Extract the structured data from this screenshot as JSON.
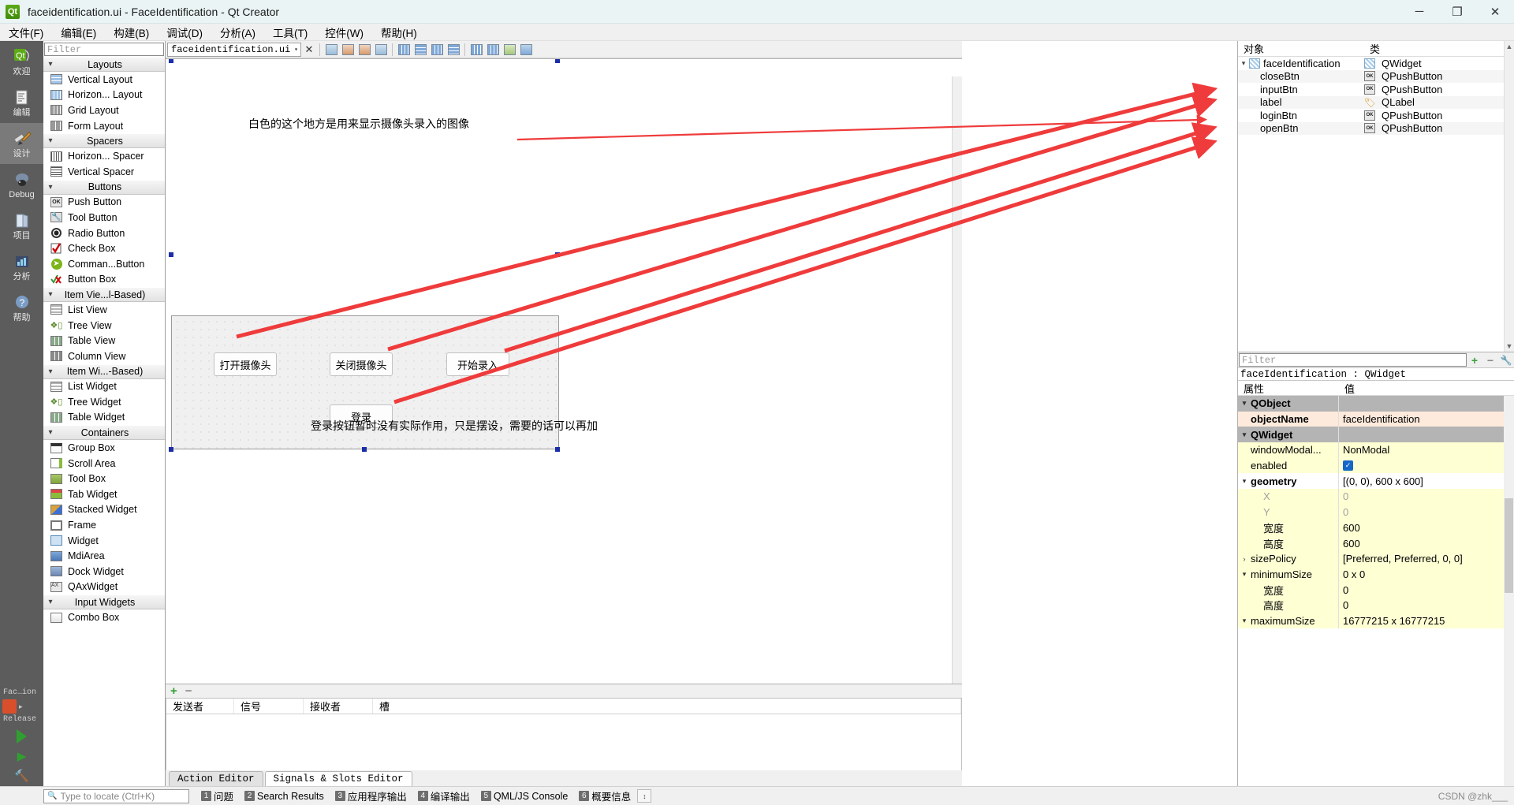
{
  "titlebar": {
    "icon": "qt-logo-icon",
    "title": "faceidentification.ui - FaceIdentification - Qt Creator",
    "minimize": "─",
    "maximize": "❐",
    "close": "✕"
  },
  "menubar": {
    "items": [
      {
        "label": "文件(F)"
      },
      {
        "label": "编辑(E)"
      },
      {
        "label": "构建(B)"
      },
      {
        "label": "调试(D)"
      },
      {
        "label": "分析(A)"
      },
      {
        "label": "工具(T)"
      },
      {
        "label": "控件(W)"
      },
      {
        "label": "帮助(H)"
      }
    ]
  },
  "modebar": {
    "items": [
      {
        "label": "欢迎",
        "icon": "qt-welcome-icon",
        "glyph": "Qt",
        "active": false
      },
      {
        "label": "编辑",
        "icon": "edit-icon",
        "glyph": "☰",
        "active": false
      },
      {
        "label": "设计",
        "icon": "design-brush-icon",
        "glyph": "✒",
        "active": true
      },
      {
        "label": "Debug",
        "icon": "debug-bug-icon",
        "glyph": "⚫",
        "active": false
      },
      {
        "label": "项目",
        "icon": "projects-icon",
        "glyph": "◧",
        "active": false
      },
      {
        "label": "分析",
        "icon": "analyze-icon",
        "glyph": "▦",
        "active": false
      },
      {
        "label": "帮助",
        "icon": "help-question-icon",
        "glyph": "?",
        "active": false
      }
    ],
    "kit_name": "Fac…ion",
    "build_config": "Release"
  },
  "widgetbox": {
    "filter_placeholder": "Filter",
    "groups": [
      {
        "label": "Layouts",
        "expanded": true,
        "items": [
          {
            "label": "Vertical Layout",
            "icon": "vertical-layout-icon"
          },
          {
            "label": "Horizon... Layout",
            "icon": "horizontal-layout-icon"
          },
          {
            "label": "Grid Layout",
            "icon": "grid-layout-icon"
          },
          {
            "label": "Form Layout",
            "icon": "form-layout-icon"
          }
        ]
      },
      {
        "label": "Spacers",
        "expanded": true,
        "items": [
          {
            "label": "Horizon... Spacer",
            "icon": "horizontal-spacer-icon"
          },
          {
            "label": "Vertical Spacer",
            "icon": "vertical-spacer-icon"
          }
        ]
      },
      {
        "label": "Buttons",
        "expanded": true,
        "items": [
          {
            "label": "Push Button",
            "icon": "push-button-icon"
          },
          {
            "label": "Tool Button",
            "icon": "tool-button-icon"
          },
          {
            "label": "Radio Button",
            "icon": "radio-button-icon"
          },
          {
            "label": "Check Box",
            "icon": "check-box-icon"
          },
          {
            "label": "Comman...Button",
            "icon": "command-link-button-icon"
          },
          {
            "label": "Button Box",
            "icon": "button-box-icon"
          }
        ]
      },
      {
        "label": "Item Vie...l-Based)",
        "expanded": true,
        "selected": true,
        "items": [
          {
            "label": "List View",
            "icon": "list-view-icon"
          },
          {
            "label": "Tree View",
            "icon": "tree-view-icon"
          },
          {
            "label": "Table View",
            "icon": "table-view-icon"
          },
          {
            "label": "Column View",
            "icon": "column-view-icon"
          }
        ]
      },
      {
        "label": "Item Wi...-Based)",
        "expanded": true,
        "selected": true,
        "items": [
          {
            "label": "List Widget",
            "icon": "list-widget-icon"
          },
          {
            "label": "Tree Widget",
            "icon": "tree-widget-icon"
          },
          {
            "label": "Table Widget",
            "icon": "table-widget-icon"
          }
        ]
      },
      {
        "label": "Containers",
        "expanded": true,
        "items": [
          {
            "label": "Group Box",
            "icon": "group-box-icon"
          },
          {
            "label": "Scroll Area",
            "icon": "scroll-area-icon"
          },
          {
            "label": "Tool Box",
            "icon": "tool-box-icon"
          },
          {
            "label": "Tab Widget",
            "icon": "tab-widget-icon"
          },
          {
            "label": "Stacked Widget",
            "icon": "stacked-widget-icon"
          },
          {
            "label": "Frame",
            "icon": "frame-icon"
          },
          {
            "label": "Widget",
            "icon": "widget-icon"
          },
          {
            "label": "MdiArea",
            "icon": "mdi-area-icon"
          },
          {
            "label": "Dock Widget",
            "icon": "dock-widget-icon"
          },
          {
            "label": "QAxWidget",
            "icon": "qax-widget-icon"
          }
        ]
      },
      {
        "label": "Input Widgets",
        "expanded": true,
        "selected": true,
        "items": [
          {
            "label": "Combo Box",
            "icon": "combo-box-icon"
          }
        ]
      }
    ]
  },
  "editor": {
    "file_name": "faceidentification.ui",
    "dropdown_arrow": "▾",
    "close_label": "✕",
    "toolbuttons": [
      {
        "name": "edit-widgets-icon"
      },
      {
        "name": "edit-signals-slots-icon"
      },
      {
        "name": "edit-buddies-icon"
      },
      {
        "name": "edit-tab-order-icon"
      },
      {
        "name": "layout-horizontally-icon"
      },
      {
        "name": "layout-vertically-icon"
      },
      {
        "name": "layout-splitter-h-icon"
      },
      {
        "name": "layout-splitter-v-icon"
      },
      {
        "name": "layout-grid-icon"
      },
      {
        "name": "layout-form-icon"
      },
      {
        "name": "break-layout-icon"
      },
      {
        "name": "adjust-size-icon"
      },
      {
        "name": "preview-icon"
      }
    ]
  },
  "form": {
    "note_top": "白色的这个地方是用来显示摄像头录入的图像",
    "note_bottom": "登录按钮暂时没有实际作用，只是摆设，需要的话可以再加",
    "buttons": [
      {
        "label": "打开摄像头",
        "name": "open-camera-button"
      },
      {
        "label": "关闭摄像头",
        "name": "close-camera-button"
      },
      {
        "label": "开始录入",
        "name": "start-input-button"
      },
      {
        "label": "登录",
        "name": "login-button"
      }
    ]
  },
  "signals_slots": {
    "add_label": "+",
    "remove_label": "−",
    "columns": [
      "发送者",
      "信号",
      "接收者",
      "槽"
    ],
    "rows": [],
    "tabs": [
      {
        "label": "Action Editor",
        "active": false
      },
      {
        "label": "Signals & Slots Editor",
        "active": true
      }
    ]
  },
  "inspector": {
    "columns": [
      "对象",
      "类"
    ],
    "rows": [
      {
        "name": "faceIdentification",
        "class": "QWidget",
        "icon": "widget-class-icon",
        "level": 0,
        "expanded": true
      },
      {
        "name": "closeBtn",
        "class": "QPushButton",
        "icon": "push-button-class-icon",
        "level": 1
      },
      {
        "name": "inputBtn",
        "class": "QPushButton",
        "icon": "push-button-class-icon",
        "level": 1
      },
      {
        "name": "label",
        "class": "QLabel",
        "icon": "label-class-icon",
        "level": 1
      },
      {
        "name": "loginBtn",
        "class": "QPushButton",
        "icon": "push-button-class-icon",
        "level": 1
      },
      {
        "name": "openBtn",
        "class": "QPushButton",
        "icon": "push-button-class-icon",
        "level": 1
      }
    ]
  },
  "properties": {
    "filter_placeholder": "Filter",
    "add_label": "+",
    "remove_label": "−",
    "configure_icon": "wrench-icon",
    "object_header": "faceIdentification : QWidget",
    "columns": [
      "属性",
      "值"
    ],
    "rows": [
      {
        "key": "QObject",
        "value": "",
        "kind": "group",
        "chev": "⌄",
        "indent": 0
      },
      {
        "key": "objectName",
        "value": "faceIdentification",
        "kind": "peach",
        "bold": true,
        "indent": 1
      },
      {
        "key": "QWidget",
        "value": "",
        "kind": "group",
        "chev": "⌄",
        "indent": 0
      },
      {
        "key": "windowModal...",
        "value": "NonModal",
        "kind": "yellow",
        "indent": 1
      },
      {
        "key": "enabled",
        "value": "",
        "kind": "yellow",
        "indent": 1,
        "checkbox": true
      },
      {
        "key": "geometry",
        "value": "[(0, 0), 600 x 600]",
        "kind": "plain",
        "bold": true,
        "chev": "⌄",
        "indent": 0
      },
      {
        "key": "X",
        "value": "0",
        "kind": "yellow",
        "indent": 2,
        "dim": true
      },
      {
        "key": "Y",
        "value": "0",
        "kind": "yellow",
        "indent": 2,
        "dim": true
      },
      {
        "key": "宽度",
        "value": "600",
        "kind": "yellow",
        "indent": 2
      },
      {
        "key": "高度",
        "value": "600",
        "kind": "yellow",
        "indent": 2
      },
      {
        "key": "sizePolicy",
        "value": "[Preferred, Preferred, 0, 0]",
        "kind": "yellow",
        "chev": "›",
        "indent": 0
      },
      {
        "key": "minimumSize",
        "value": "0 x 0",
        "kind": "yellow",
        "chev": "⌄",
        "indent": 0
      },
      {
        "key": "宽度",
        "value": "0",
        "kind": "yellow",
        "indent": 2
      },
      {
        "key": "高度",
        "value": "0",
        "kind": "yellow",
        "indent": 2
      },
      {
        "key": "maximumSize",
        "value": "16777215 x 16777215",
        "kind": "yellow",
        "chev": "⌄",
        "indent": 0
      }
    ]
  },
  "statusbar": {
    "locator_placeholder": "Type to locate (Ctrl+K)",
    "locator_icon": "magnifier-icon",
    "items": [
      {
        "num": "1",
        "label": "问题"
      },
      {
        "num": "2",
        "label": "Search Results"
      },
      {
        "num": "3",
        "label": "应用程序输出"
      },
      {
        "num": "4",
        "label": "编译输出"
      },
      {
        "num": "5",
        "label": "QML/JS Console"
      },
      {
        "num": "6",
        "label": "概要信息"
      }
    ],
    "toggle_icon": "updown-arrows-icon",
    "watermark": "CSDN @zhk___"
  },
  "colors": {
    "arrow_red": "#ef3b3b",
    "accent_blue": "#1668c8",
    "mode_active": "#7a7a7a",
    "property_yellow": "#ffffd4",
    "property_peach": "#fdeadc"
  }
}
